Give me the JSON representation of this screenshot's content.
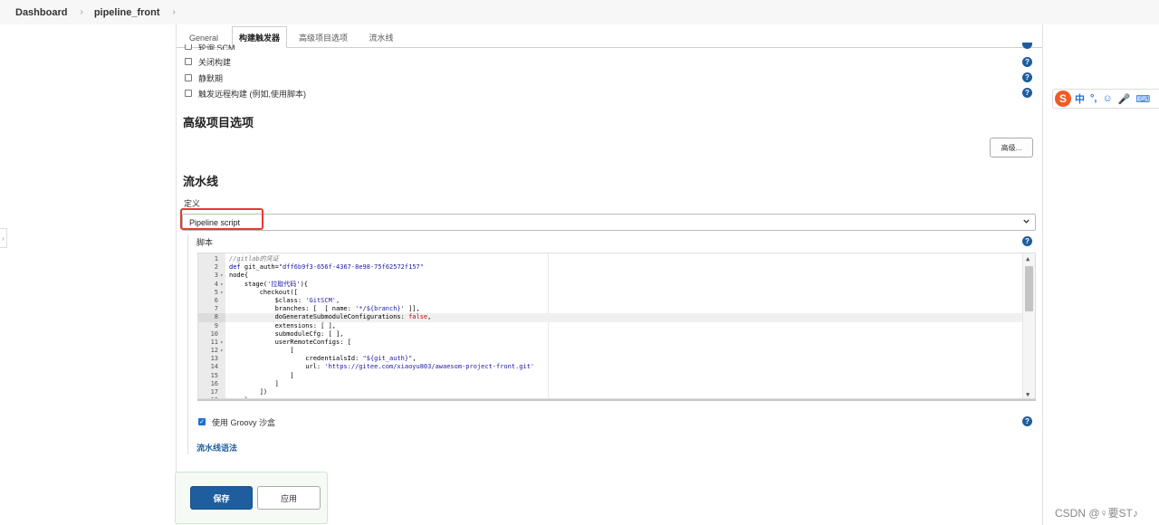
{
  "breadcrumb": {
    "items": [
      "Dashboard",
      "pipeline_front"
    ],
    "separator": "›"
  },
  "tabs": [
    {
      "label": "General",
      "active": false
    },
    {
      "label": "构建触发器",
      "active": true
    },
    {
      "label": "高级项目选项",
      "active": false
    },
    {
      "label": "流水线",
      "active": false
    }
  ],
  "triggers": {
    "partial_label": "轮询 SCM",
    "items": [
      {
        "label": "关闭构建",
        "checked": false
      },
      {
        "label": "静默期",
        "checked": false
      },
      {
        "label": "触发远程构建 (例如,使用脚本)",
        "checked": false
      }
    ]
  },
  "advanced": {
    "title": "高级项目选项",
    "button_label": "高级..."
  },
  "pipeline": {
    "title": "流水线",
    "definition_label": "定义",
    "definition_value": "Pipeline script",
    "script_label": "脚本",
    "sandbox_label": "使用 Groovy 沙盒",
    "sandbox_checked": true,
    "syntax_link": "流水线语法"
  },
  "editor": {
    "active_line": 8,
    "lines": [
      {
        "n": "1",
        "fold": false,
        "code": "//gitlab的凭证"
      },
      {
        "n": "2",
        "fold": false,
        "code": "def git_auth=\"dff6b9f3-656f-4367-8e98-75f62572f157\""
      },
      {
        "n": "3",
        "fold": true,
        "code": "node{"
      },
      {
        "n": "4",
        "fold": true,
        "code": "    stage('拉取代码'){"
      },
      {
        "n": "5",
        "fold": true,
        "code": "        checkout(["
      },
      {
        "n": "6",
        "fold": false,
        "code": "            $class: 'GitSCM',"
      },
      {
        "n": "7",
        "fold": false,
        "code": "            branches: [  [ name: '*/${branch}' ]],"
      },
      {
        "n": "8",
        "fold": false,
        "code": "            doGenerateSubmoduleConfigurations: false,"
      },
      {
        "n": "9",
        "fold": false,
        "code": "            extensions: [ ],"
      },
      {
        "n": "10",
        "fold": false,
        "code": "            submoduleCfg: [ ],"
      },
      {
        "n": "11",
        "fold": true,
        "code": "            userRemoteConfigs: ["
      },
      {
        "n": "12",
        "fold": true,
        "code": "                ["
      },
      {
        "n": "13",
        "fold": false,
        "code": "                    credentialsId: \"${git_auth}\","
      },
      {
        "n": "14",
        "fold": false,
        "code": "                    url: 'https://gitee.com/xiaoyu803/awaesom-project-front.git'"
      },
      {
        "n": "15",
        "fold": false,
        "code": "                ]"
      },
      {
        "n": "16",
        "fold": false,
        "code": "            ]"
      },
      {
        "n": "17",
        "fold": false,
        "code": "        ])"
      },
      {
        "n": "18",
        "fold": false,
        "code": "    }"
      }
    ]
  },
  "footer": {
    "save_label": "保存",
    "apply_label": "应用"
  },
  "ime": {
    "logo": "S",
    "items": [
      "中",
      "°,",
      "☺",
      "🎤",
      "⌨"
    ]
  },
  "watermark": "CSDN @♀要ST♪",
  "help_glyph": "?",
  "colors": {
    "primary": "#1e5e9e",
    "highlight_box": "#e53935",
    "link": "#1e5e9e",
    "ime_brand": "#f05a28"
  }
}
